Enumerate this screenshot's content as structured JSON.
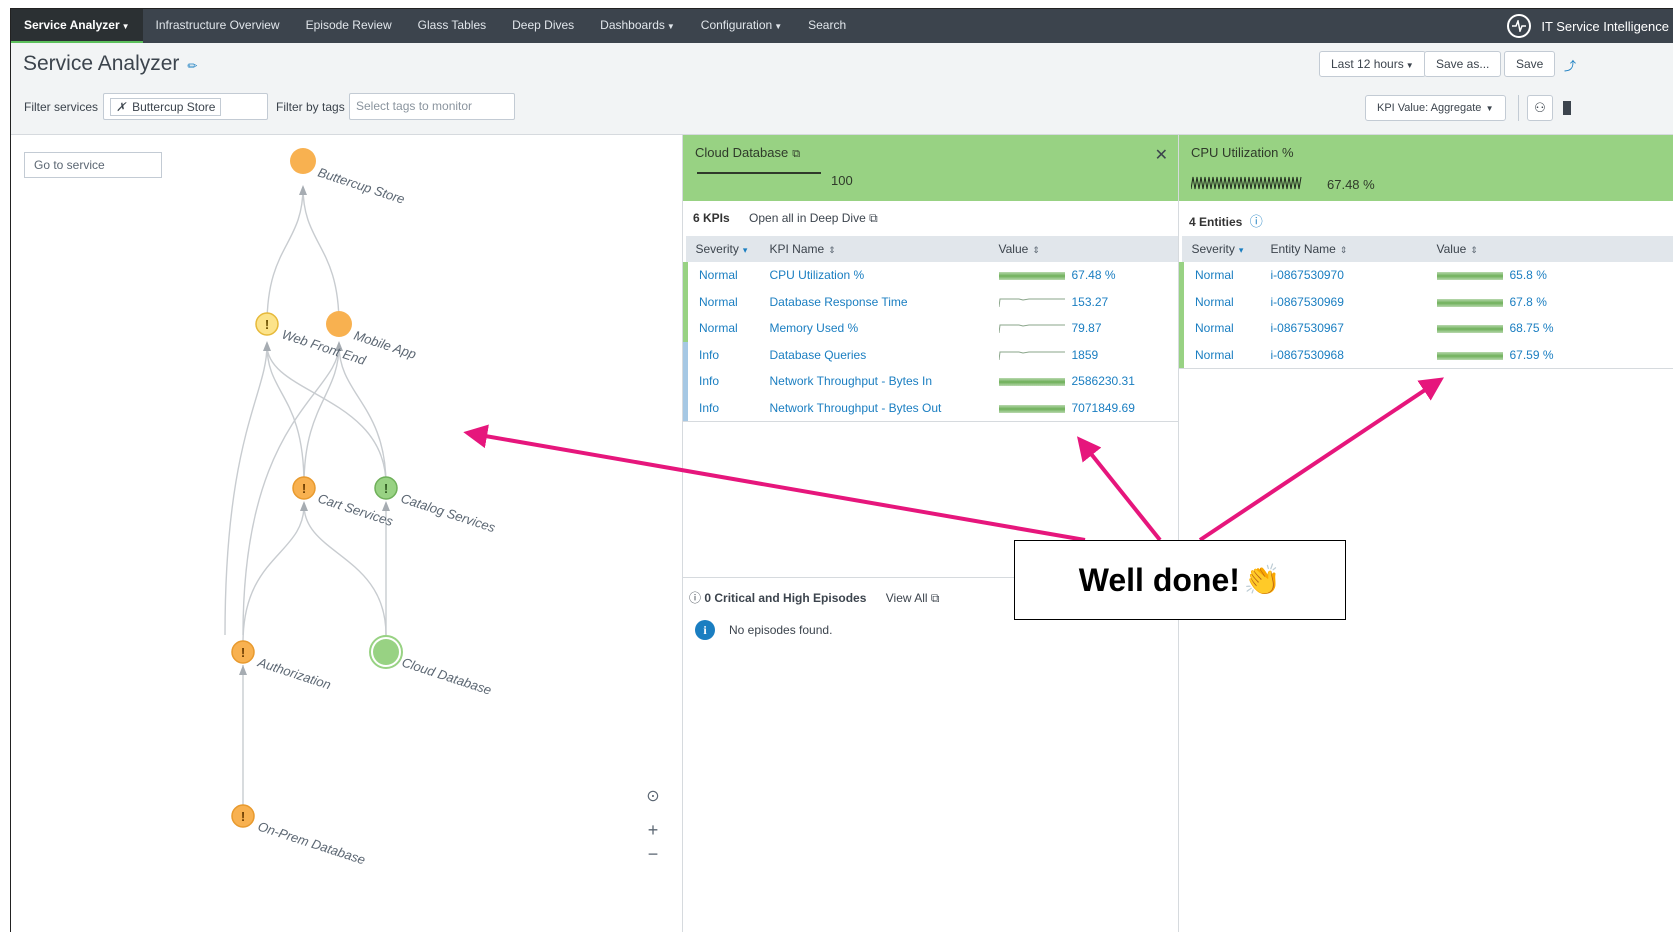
{
  "nav": {
    "items": [
      {
        "label": "Service Analyzer",
        "caret": true,
        "active": true
      },
      {
        "label": "Infrastructure Overview",
        "caret": false
      },
      {
        "label": "Episode Review",
        "caret": false
      },
      {
        "label": "Glass Tables",
        "caret": false
      },
      {
        "label": "Deep Dives",
        "caret": false
      },
      {
        "label": "Dashboards",
        "caret": true
      },
      {
        "label": "Configuration",
        "caret": true
      },
      {
        "label": "Search",
        "caret": false
      }
    ],
    "brand": "IT Service Intelligence"
  },
  "header": {
    "title": "Service Analyzer",
    "time_range": "Last 12 hours",
    "save_as": "Save as...",
    "save": "Save",
    "filter_services_label": "Filter services",
    "filter_chip": "Buttercup Store",
    "filter_tags_label": "Filter by tags",
    "filter_tags_placeholder": "Select tags to monitor",
    "kpi_value_select": "KPI Value: Aggregate"
  },
  "topology": {
    "goto_placeholder": "Go to service",
    "nodes": [
      {
        "label": "Buttercup Store",
        "status": "high"
      },
      {
        "label": "Web Front End",
        "status": "medium"
      },
      {
        "label": "Mobile App",
        "status": "high"
      },
      {
        "label": "Cart Services",
        "status": "high"
      },
      {
        "label": "Catalog Services",
        "status": "normal"
      },
      {
        "label": "Authorization",
        "status": "high"
      },
      {
        "label": "Cloud Database",
        "status": "normal"
      },
      {
        "label": "On-Prem Database",
        "status": "high"
      }
    ]
  },
  "kpi_panel": {
    "title": "Cloud Database",
    "health_score": "100",
    "kpi_count": "6 KPIs",
    "open_all": "Open all in Deep Dive",
    "columns": [
      "Severity",
      "KPI Name",
      "Value"
    ],
    "rows": [
      {
        "severity": "Normal",
        "name": "CPU Utilization %",
        "value": "67.48 %",
        "spark": "dense"
      },
      {
        "severity": "Normal",
        "name": "Database Response Time",
        "value": "153.27",
        "spark": "flat"
      },
      {
        "severity": "Normal",
        "name": "Memory Used %",
        "value": "79.87",
        "spark": "flat"
      },
      {
        "severity": "Info",
        "name": "Database Queries",
        "value": "1859",
        "spark": "flat"
      },
      {
        "severity": "Info",
        "name": "Network Throughput - Bytes In",
        "value": "2586230.31",
        "spark": "dense"
      },
      {
        "severity": "Info",
        "name": "Network Throughput - Bytes Out",
        "value": "7071849.69",
        "spark": "dense"
      }
    ],
    "episodes_header": "0 Critical and High Episodes",
    "view_all": "View All",
    "no_episodes": "No episodes found."
  },
  "entity_panel": {
    "title": "CPU Utilization %",
    "headline_value": "67.48 %",
    "entity_count": "4 Entities",
    "columns": [
      "Severity",
      "Entity Name",
      "Value"
    ],
    "rows": [
      {
        "severity": "Normal",
        "name": "i-0867530970",
        "value": "65.8 %"
      },
      {
        "severity": "Normal",
        "name": "i-0867530969",
        "value": "67.8 %"
      },
      {
        "severity": "Normal",
        "name": "i-0867530967",
        "value": "68.75 %"
      },
      {
        "severity": "Normal",
        "name": "i-0867530968",
        "value": "67.59 %"
      }
    ]
  },
  "annotation": {
    "callout_text": "Well done!",
    "arrow_color": "#e6167c"
  },
  "colors": {
    "nav_bg": "#3c444d",
    "high": "#f8b150",
    "medium": "#fce38a",
    "normal": "#98d283",
    "link": "#1a7ec1"
  }
}
